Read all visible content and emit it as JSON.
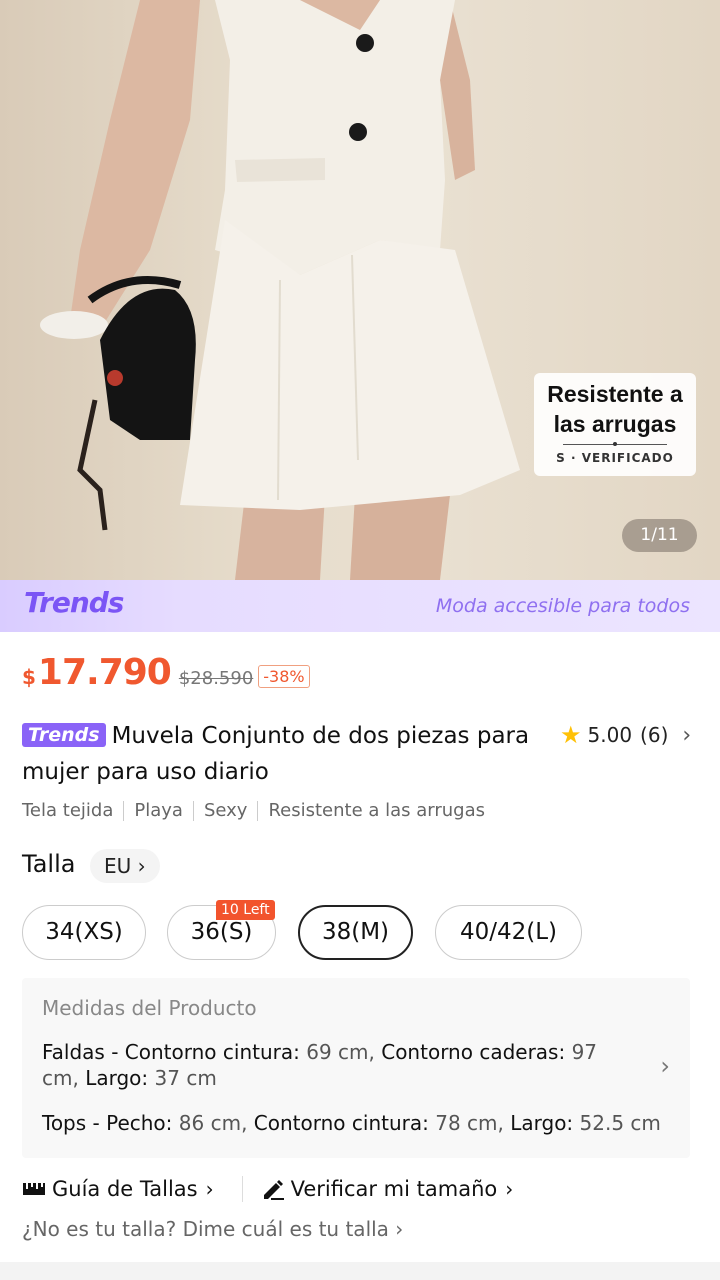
{
  "hero": {
    "badge_title_line1": "Resistente a",
    "badge_title_line2": "las arrugas",
    "badge_subtitle": "S · VERIFICADO",
    "page_indicator": "1/11"
  },
  "trends_banner": {
    "logo": "Trends",
    "tagline": "Moda accesible para todos"
  },
  "price": {
    "currency": "$",
    "current": "17.790",
    "original": "$28.590",
    "discount": "-38%"
  },
  "product": {
    "badge": "Trends",
    "title": "Muvela Conjunto de dos piezas para mujer para uso diario",
    "rating": "5.00",
    "rating_count": "(6)"
  },
  "attributes": [
    "Tela tejida",
    "Playa",
    "Sexy",
    "Resistente a las arrugas"
  ],
  "size": {
    "label": "Talla",
    "region": "EU",
    "options": [
      {
        "label": "34(XS)"
      },
      {
        "label": "36(S)",
        "tag": "10 Left"
      },
      {
        "label": "38(M)",
        "selected": true
      },
      {
        "label": "40/42(L)"
      }
    ]
  },
  "measurements": {
    "title": "Medidas del Producto",
    "faldas": {
      "name": "Faldas -",
      "k1": "Contorno cintura:",
      "v1": "69 cm,",
      "k2": "Contorno caderas:",
      "v2": "97 cm,",
      "k3": "Largo:",
      "v3": "37 cm"
    },
    "tops": {
      "name": "Tops -",
      "k1": "Pecho:",
      "v1": "86 cm,",
      "k2": "Contorno cintura:",
      "v2": "78 cm,",
      "k3": "Largo:",
      "v3": "52.5 cm"
    }
  },
  "guides": {
    "size_guide": "Guía de Tallas",
    "verify_size": "Verificar mi tamaño",
    "not_your_size": "¿No es tu talla? Dime cuál es tu talla"
  },
  "colors": {
    "accent": "#f0582f",
    "trends_purple": "#8a63f7"
  }
}
